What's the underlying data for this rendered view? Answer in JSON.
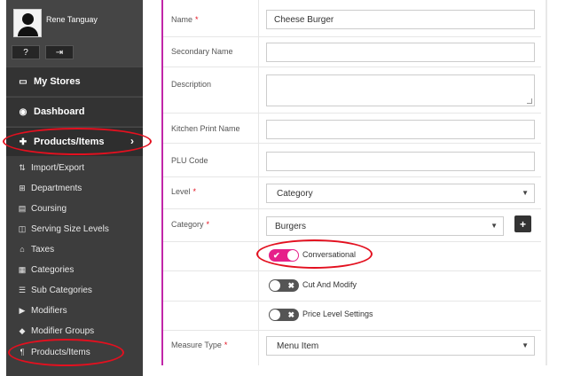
{
  "user": {
    "name": "Rene Tanguay",
    "help_label": "?",
    "logout_label": "⇥"
  },
  "menu": {
    "my_stores": {
      "icon": "store-icon",
      "glyph": "▭",
      "label": "My Stores"
    },
    "dashboard": {
      "icon": "dashboard-icon",
      "glyph": "◉",
      "label": "Dashboard"
    },
    "products": {
      "icon": "basket-icon",
      "glyph": "✚",
      "label": "Products/Items",
      "chevron": "›"
    }
  },
  "submenu": [
    {
      "icon": "import-export-icon",
      "glyph": "⇅",
      "label": "Import/Export"
    },
    {
      "icon": "departments-icon",
      "glyph": "⊞",
      "label": "Departments"
    },
    {
      "icon": "coursing-icon",
      "glyph": "▤",
      "label": "Coursing"
    },
    {
      "icon": "serving-size-icon",
      "glyph": "◫",
      "label": "Serving Size Levels"
    },
    {
      "icon": "taxes-icon",
      "glyph": "⌂",
      "label": "Taxes"
    },
    {
      "icon": "categories-icon",
      "glyph": "▦",
      "label": "Categories"
    },
    {
      "icon": "sub-categories-icon",
      "glyph": "☰",
      "label": "Sub Categories"
    },
    {
      "icon": "modifiers-icon",
      "glyph": "▶",
      "label": "Modifiers"
    },
    {
      "icon": "modifier-groups-icon",
      "glyph": "◆",
      "label": "Modifier Groups"
    },
    {
      "icon": "products-items-icon",
      "glyph": "¶",
      "label": "Products/Items"
    }
  ],
  "form": {
    "name": {
      "label": "Name",
      "required": "*",
      "value": "Cheese Burger"
    },
    "secondary_name": {
      "label": "Secondary Name",
      "value": ""
    },
    "description": {
      "label": "Description",
      "value": ""
    },
    "kitchen_print_name": {
      "label": "Kitchen Print Name",
      "value": ""
    },
    "plu_code": {
      "label": "PLU Code",
      "value": ""
    },
    "level": {
      "label": "Level",
      "required": "*",
      "value": "Category",
      "caret": "▼"
    },
    "category": {
      "label": "Category",
      "required": "*",
      "value": "Burgers",
      "caret": "▼",
      "add_label": "+"
    },
    "conversational": {
      "label": "Conversational",
      "checked": true,
      "mark": "✔"
    },
    "cut_and_modify": {
      "label": "Cut And Modify",
      "checked": false,
      "mark": "✖"
    },
    "price_level_settings": {
      "label": "Price Level Settings",
      "checked": false,
      "mark": "✖"
    },
    "measure_type": {
      "label": "Measure Type",
      "required": "*",
      "value": "Menu Item",
      "caret": "▼"
    }
  },
  "colors": {
    "accent_pink": "#e6208a",
    "annotation_red": "#e3101f",
    "sidebar": "#3d3d3d",
    "form_border": "#c026a8"
  }
}
